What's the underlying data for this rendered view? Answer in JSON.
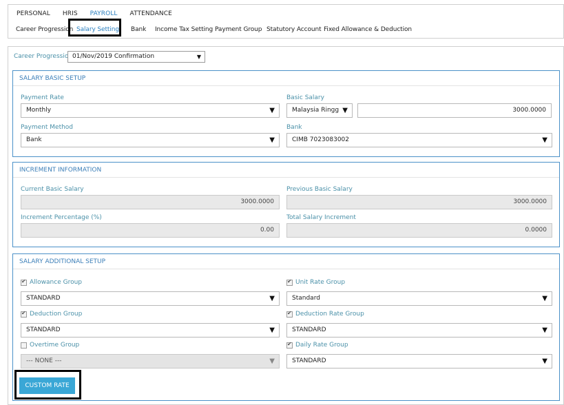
{
  "top_nav": {
    "items": [
      {
        "label": "PERSONAL"
      },
      {
        "label": "HRIS"
      },
      {
        "label": "PAYROLL"
      },
      {
        "label": "ATTENDANCE"
      }
    ]
  },
  "sub_nav": {
    "items": [
      {
        "label": "Career Progression"
      },
      {
        "label": "Salary Setting"
      },
      {
        "label": "Bank"
      },
      {
        "label": "Income Tax Setting"
      },
      {
        "label": "Payment Group"
      },
      {
        "label": "Statutory Account"
      },
      {
        "label": "Fixed Allowance & Deduction"
      }
    ]
  },
  "career_progression": {
    "label": "Career Progression:",
    "value": "01/Nov/2019 Confirmation"
  },
  "salary_basic_setup": {
    "title": "SALARY BASIC SETUP",
    "payment_rate_label": "Payment Rate",
    "payment_rate_value": "Monthly",
    "basic_salary_label": "Basic Salary",
    "currency_value": "Malaysia Ringg",
    "basic_salary_value": "3000.0000",
    "payment_method_label": "Payment Method",
    "payment_method_value": "Bank",
    "bank_label": "Bank",
    "bank_value": "CIMB 7023083002"
  },
  "increment_information": {
    "title": "INCREMENT INFORMATION",
    "current_basic_label": "Current Basic Salary",
    "current_basic_value": "3000.0000",
    "previous_basic_label": "Previous Basic Salary",
    "previous_basic_value": "3000.0000",
    "increment_pct_label": "Increment Percentage (%)",
    "increment_pct_value": "0.00",
    "total_increment_label": "Total Salary Increment",
    "total_increment_value": "0.0000"
  },
  "salary_additional_setup": {
    "title": "SALARY ADDITIONAL SETUP",
    "allowance_group_label": "Allowance Group",
    "allowance_group_value": "STANDARD",
    "unit_rate_group_label": "Unit Rate Group",
    "unit_rate_group_value": "Standard",
    "deduction_group_label": "Deduction Group",
    "deduction_group_value": "STANDARD",
    "deduction_rate_group_label": "Deduction Rate Group",
    "deduction_rate_group_value": "STANDARD",
    "overtime_group_label": "Overtime Group",
    "overtime_group_value": "--- NONE ---",
    "daily_rate_group_label": "Daily Rate Group",
    "daily_rate_group_value": "STANDARD",
    "custom_rate_button": "CUSTOM RATE"
  },
  "colors": {
    "accent": "#2a7fbf",
    "label": "#4a90a8",
    "section_border": "#4a90c8",
    "button": "#3aa7d6"
  },
  "icons": {
    "dropdown": "chevron-down-icon",
    "checkbox": "checkbox-icon"
  }
}
